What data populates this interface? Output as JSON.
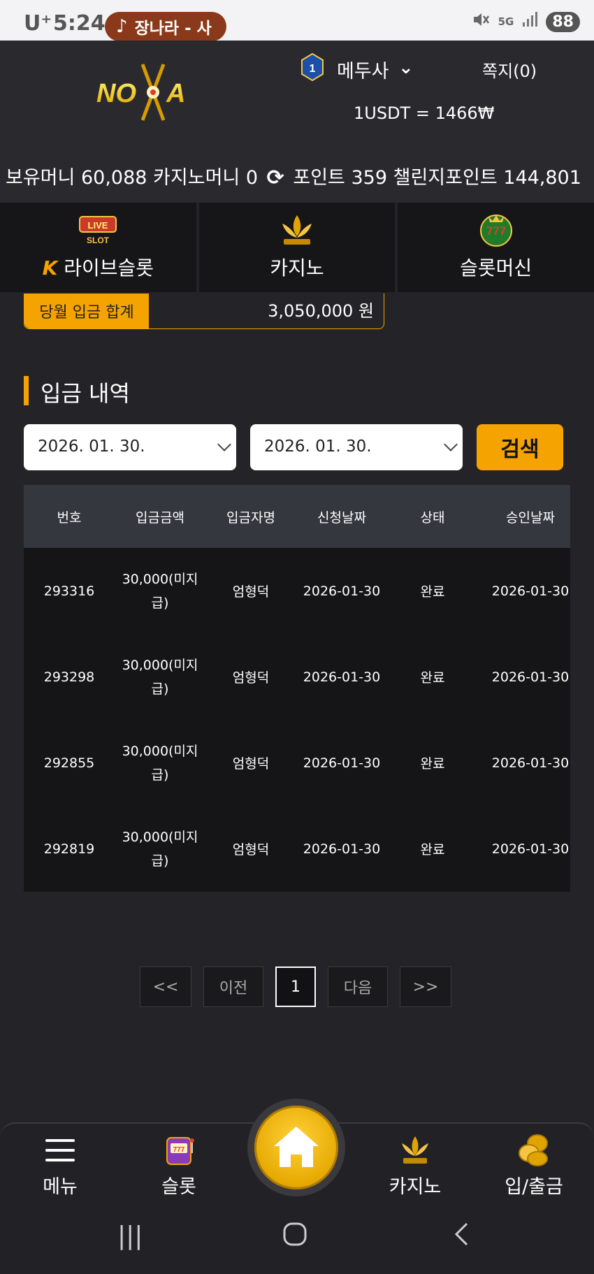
{
  "status_bar": {
    "carrier": "U⁺",
    "time": "5:24",
    "media_text": "장나라 - 사",
    "network": "5G",
    "battery": "88"
  },
  "header": {
    "logo_text": "NOVA",
    "level": "1",
    "username": "메두사",
    "messages": "쪽지(0)",
    "exchange_rate": "1USDT = 1466₩"
  },
  "balances": {
    "money_label": "보유머니",
    "money_value": "60,088",
    "casino_label": "카지노머니",
    "casino_value": "0",
    "point_label": "포인트",
    "point_value": "359",
    "challenge_label": "챌린지포인트",
    "challenge_value": "144,801"
  },
  "categories": [
    {
      "label": "라이브슬롯",
      "icon": "live-slot-icon"
    },
    {
      "label": "카지노",
      "icon": "k-slot-lotus-icon"
    },
    {
      "label": "슬롯머신",
      "icon": "777-slots-icon"
    }
  ],
  "monthly_total": {
    "label": "당월 입금 합계",
    "value": "3,050,000 원"
  },
  "section_title": "입금 내역",
  "search": {
    "date_from": "2026. 01. 30.",
    "date_to": "2026. 01. 30.",
    "button": "검색"
  },
  "table": {
    "headers": [
      "번호",
      "입금금액",
      "입금자명",
      "신청날짜",
      "상태",
      "승인날짜"
    ],
    "rows": [
      {
        "id": "293316",
        "amount": "30,000(미지급)",
        "name": "엄형덕",
        "requested": "2026-01-30",
        "status": "완료",
        "approved": "2026-01-30"
      },
      {
        "id": "293298",
        "amount": "30,000(미지급)",
        "name": "엄형덕",
        "requested": "2026-01-30",
        "status": "완료",
        "approved": "2026-01-30"
      },
      {
        "id": "292855",
        "amount": "30,000(미지급)",
        "name": "엄형덕",
        "requested": "2026-01-30",
        "status": "완료",
        "approved": "2026-01-30"
      },
      {
        "id": "292819",
        "amount": "30,000(미지급)",
        "name": "엄형덕",
        "requested": "2026-01-30",
        "status": "완료",
        "approved": "2026-01-30"
      }
    ]
  },
  "pagination": {
    "first": "<<",
    "prev": "이전",
    "current": "1",
    "next": "다음",
    "last": ">>"
  },
  "bottom_nav": {
    "menu": "메뉴",
    "slot": "슬롯",
    "casino": "카지노",
    "deposit": "입/출금"
  },
  "colors": {
    "accent": "#f5a300",
    "background": "#242428",
    "header": "#2a2a2e",
    "table_header": "#34373e",
    "table_body": "#151517"
  }
}
